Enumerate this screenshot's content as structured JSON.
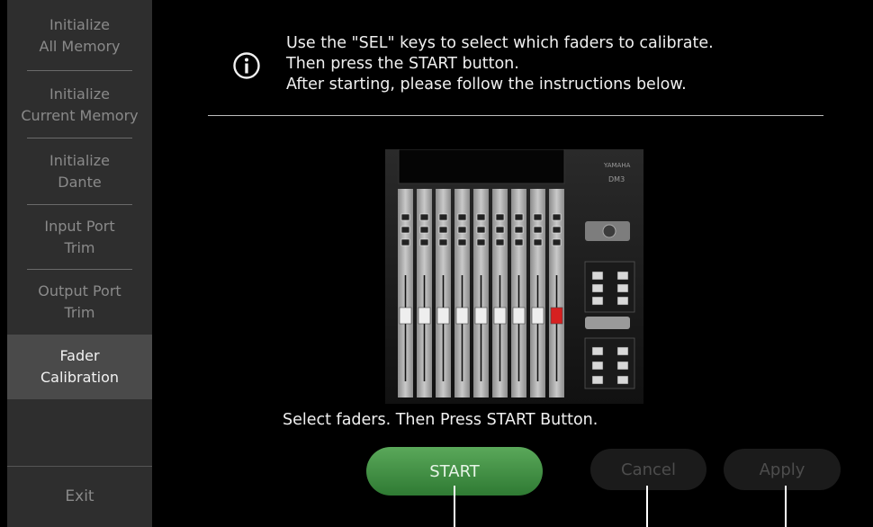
{
  "sidebar": {
    "items": [
      {
        "label": "Initialize\nAll Memory",
        "active": false
      },
      {
        "label": "Initialize\nCurrent Memory",
        "active": false
      },
      {
        "label": "Initialize\nDante",
        "active": false
      },
      {
        "label": "Input Port\nTrim",
        "active": false
      },
      {
        "label": "Output Port\nTrim",
        "active": false
      },
      {
        "label": "Fader\nCalibration",
        "active": true
      }
    ],
    "exit_label": "Exit"
  },
  "main": {
    "instructions": [
      "Use the \"SEL\" keys to select which faders to calibrate.",
      "Then press the START button.",
      "After starting, please follow the instructions below."
    ],
    "console": {
      "brand": "YAMAHA",
      "model": "DM3"
    },
    "status_message": "Select faders. Then Press START Button.",
    "buttons": {
      "start": "START",
      "cancel": "Cancel",
      "apply": "Apply"
    }
  },
  "colors": {
    "start_green": "#3e8e41",
    "active_item_bg": "#4a4a4a",
    "sidebar_bg": "#2e2e2e"
  }
}
